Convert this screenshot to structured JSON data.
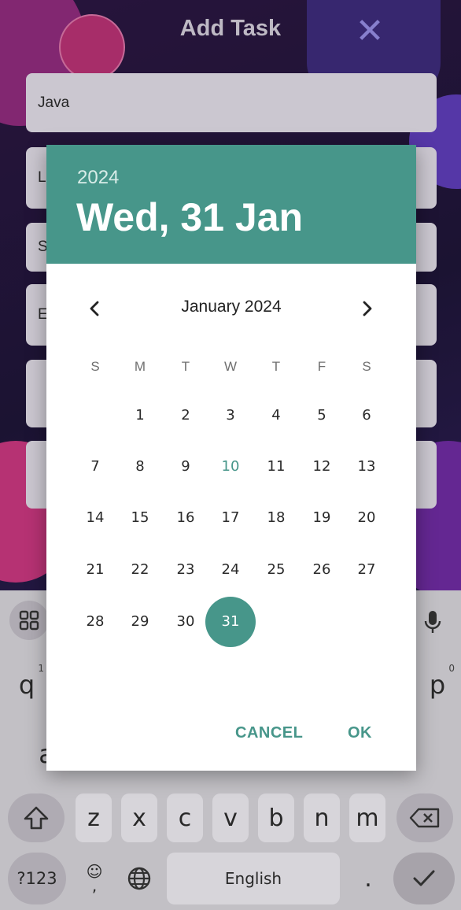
{
  "app": {
    "title": "Add Task",
    "close_icon": "close-icon",
    "fields": [
      {
        "value": "Java"
      },
      {
        "value": "L"
      },
      {
        "value": "S"
      },
      {
        "value": "E"
      },
      {
        "value": ""
      },
      {
        "value": ""
      }
    ]
  },
  "date_picker": {
    "header": {
      "year": "2024",
      "selected_date": "Wed, 31 Jan"
    },
    "month_label": "January 2024",
    "prev_icon": "chevron-left-icon",
    "next_icon": "chevron-right-icon",
    "weekdays": [
      "S",
      "M",
      "T",
      "W",
      "T",
      "F",
      "S"
    ],
    "weeks": [
      [
        "",
        "1",
        "2",
        "3",
        "4",
        "5",
        "6"
      ],
      [
        "7",
        "8",
        "9",
        "10",
        "11",
        "12",
        "13"
      ],
      [
        "14",
        "15",
        "16",
        "17",
        "18",
        "19",
        "20"
      ],
      [
        "21",
        "22",
        "23",
        "24",
        "25",
        "26",
        "27"
      ],
      [
        "28",
        "29",
        "30",
        "31",
        "",
        "",
        ""
      ]
    ],
    "today": "10",
    "selected": "31",
    "cancel_label": "CANCEL",
    "ok_label": "OK",
    "accent_color": "#47968a"
  },
  "keyboard": {
    "toolbar_icon": "grid-icon",
    "mic_icon": "mic-icon",
    "row1_left": "q",
    "row1_left_hint": "1",
    "row1_right": "p",
    "row1_right_hint": "0",
    "row2_left": "a",
    "row3": [
      "z",
      "x",
      "c",
      "v",
      "b",
      "n",
      "m"
    ],
    "shift_icon": "shift-icon",
    "backspace_icon": "backspace-icon",
    "symbols_label": "?123",
    "emoji_icon": "emoji-icon",
    "comma": ",",
    "globe_icon": "globe-icon",
    "space_label": "English",
    "period": ".",
    "enter_icon": "checkmark-icon"
  }
}
